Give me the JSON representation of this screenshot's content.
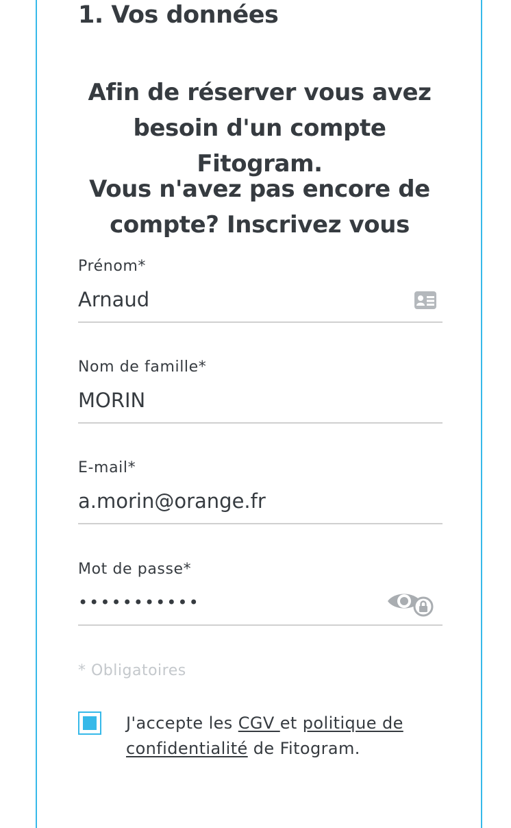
{
  "section": {
    "title": "1. Vos données"
  },
  "intro": {
    "line1": "Afin de réserver vous avez besoin d'un compte Fitogram.",
    "line2": "Vous n'avez pas encore de compte? Inscrivez vous"
  },
  "form": {
    "first_name": {
      "label": "Prénom*",
      "value": "Arnaud",
      "icon": "contact-card-icon"
    },
    "last_name": {
      "label": "Nom de famille*",
      "value": "MORIN"
    },
    "email": {
      "label": "E-mail*",
      "value": "a.morin@orange.fr"
    },
    "password": {
      "label": "Mot de passe*",
      "value": "•••••••••••",
      "icon": "show-password-icon"
    },
    "required_note": "* Obligatoires"
  },
  "terms": {
    "checked": true,
    "prefix": "J'accepte les ",
    "cgv_link": "CGV ",
    "middle": "et ",
    "privacy_link": "politique de confidentialité",
    "suffix": " de Fitogram."
  },
  "colors": {
    "accent": "#36b9e9",
    "text": "#363b40",
    "muted": "#c4c8cc",
    "divider": "#d0d0d0"
  }
}
